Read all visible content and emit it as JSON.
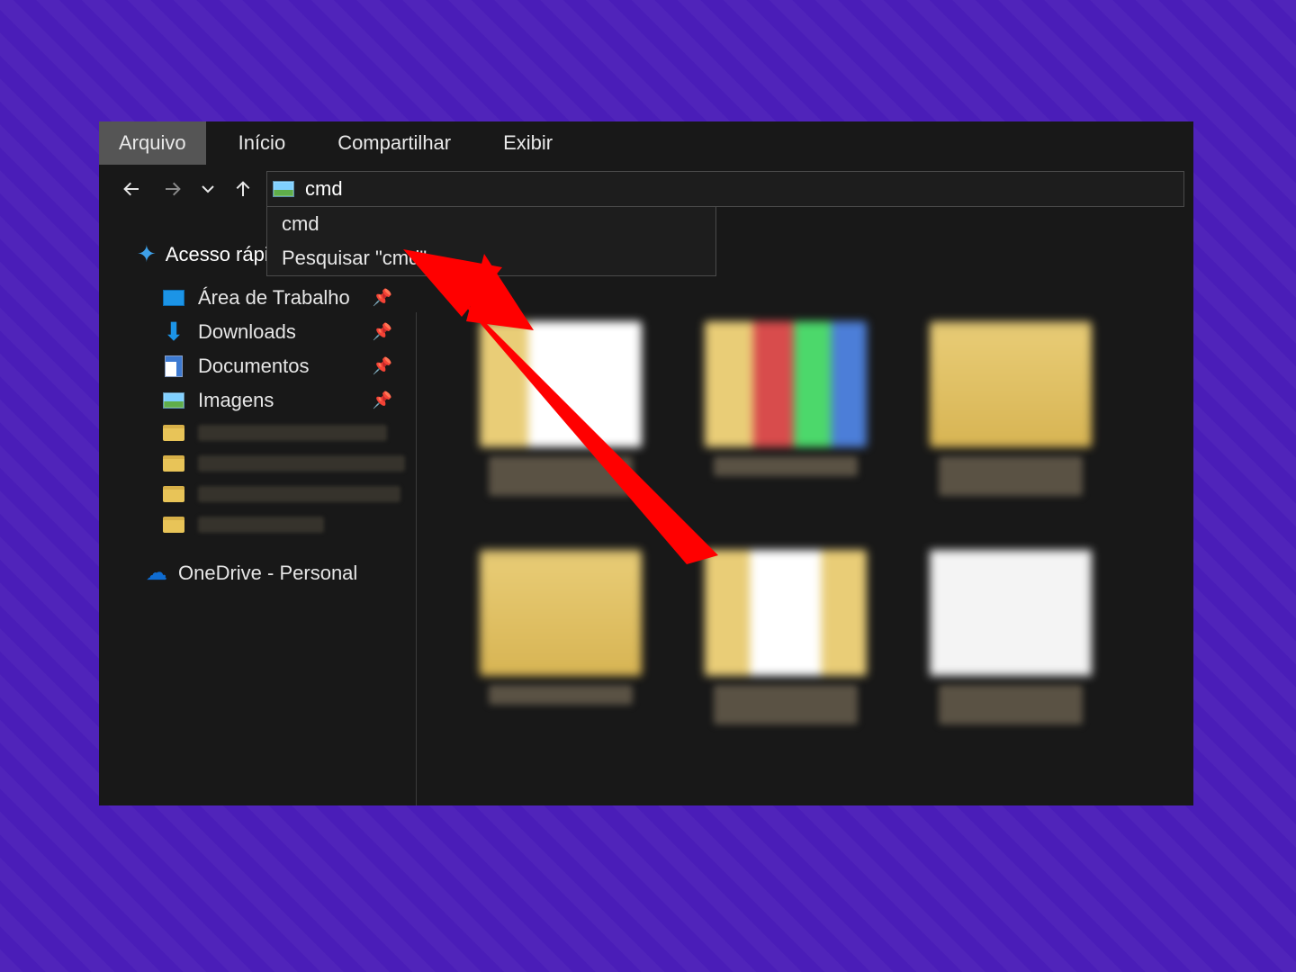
{
  "menubar": {
    "file": "Arquivo",
    "home": "Início",
    "share": "Compartilhar",
    "view": "Exibir"
  },
  "addressbar": {
    "value": "cmd",
    "suggestions": [
      {
        "label": "cmd"
      },
      {
        "label": "Pesquisar \"cmd\""
      }
    ]
  },
  "sidebar": {
    "quick_access": "Acesso rápido",
    "items": [
      {
        "label": "Área de Trabalho"
      },
      {
        "label": "Downloads"
      },
      {
        "label": "Documentos"
      },
      {
        "label": "Imagens"
      }
    ],
    "onedrive": "OneDrive - Personal"
  },
  "annotation": {
    "color": "#ff0000"
  }
}
